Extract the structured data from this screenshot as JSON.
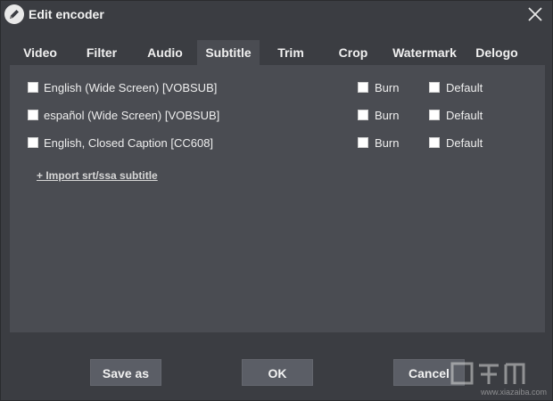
{
  "window": {
    "title": "Edit encoder"
  },
  "tabs": [
    {
      "label": "Video"
    },
    {
      "label": "Filter"
    },
    {
      "label": "Audio"
    },
    {
      "label": "Subtitle",
      "active": true
    },
    {
      "label": "Trim"
    },
    {
      "label": "Crop"
    },
    {
      "label": "Watermark"
    },
    {
      "label": "Delogo"
    }
  ],
  "subtitles": [
    {
      "name": "English (Wide Screen) [VOBSUB]",
      "burn_label": "Burn",
      "default_label": "Default"
    },
    {
      "name": "español (Wide Screen) [VOBSUB]",
      "burn_label": "Burn",
      "default_label": "Default"
    },
    {
      "name": "English, Closed Caption [CC608]",
      "burn_label": "Burn",
      "default_label": "Default"
    }
  ],
  "import_link": "+ Import srt/ssa subtitle",
  "buttons": {
    "save_as": "Save as",
    "ok": "OK",
    "cancel": "Cancel"
  },
  "watermark_text": "www.xiazaiba.com",
  "colors": {
    "background": "#3b3d42",
    "panel": "#4a4c52",
    "button": "#5b5e66"
  }
}
